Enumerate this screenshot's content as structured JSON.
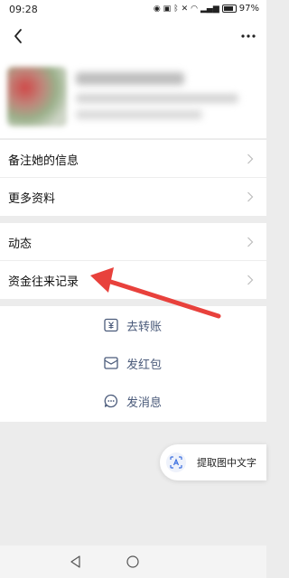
{
  "status_bar": {
    "time": "09:28",
    "battery": "97%"
  },
  "nav": {
    "back_icon": "back-chevron-icon",
    "more_icon": "more-dots-icon"
  },
  "menu_group1": [
    {
      "label": "备注她的信息"
    },
    {
      "label": "更多资料"
    }
  ],
  "menu_group2": [
    {
      "label": "动态"
    },
    {
      "label": "资金往来记录"
    }
  ],
  "actions": [
    {
      "label": "去转账",
      "icon": "yuan-transfer-icon"
    },
    {
      "label": "发红包",
      "icon": "red-packet-icon"
    },
    {
      "label": "发消息",
      "icon": "message-bubble-icon"
    }
  ],
  "float_pill": {
    "label": "提取图中文字",
    "icon": "text-scan-icon"
  },
  "colors": {
    "action_text": "#4a5a7a",
    "arrow": "#e8413c",
    "background": "#ececec"
  }
}
